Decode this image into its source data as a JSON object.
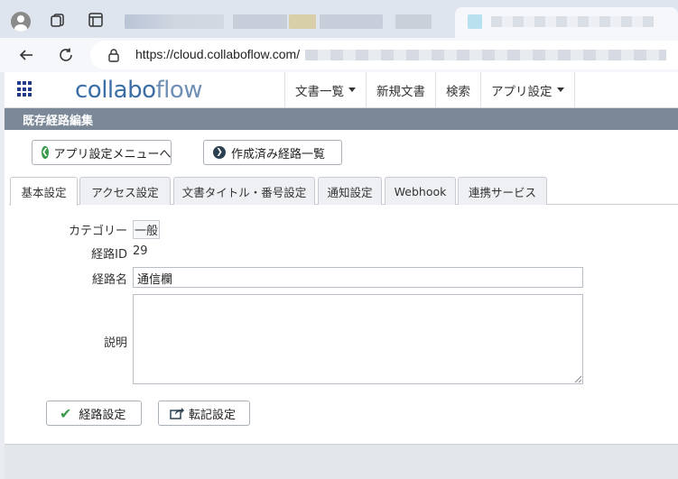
{
  "browser": {
    "url": "https://cloud.collaboflow.com/"
  },
  "app": {
    "logo_main": "collabo",
    "logo_accent": "flow",
    "nav": [
      {
        "label": "文書一覧",
        "dropdown": true
      },
      {
        "label": "新規文書",
        "dropdown": false
      },
      {
        "label": "検索",
        "dropdown": false
      },
      {
        "label": "アプリ設定",
        "dropdown": true
      }
    ]
  },
  "page": {
    "title": "既存経路編集",
    "back_button": "アプリ設定メニューへ",
    "list_button": "作成済み経路一覧"
  },
  "tabs": [
    {
      "label": "基本設定",
      "active": true
    },
    {
      "label": "アクセス設定",
      "active": false
    },
    {
      "label": "文書タイトル・番号設定",
      "active": false
    },
    {
      "label": "通知設定",
      "active": false
    },
    {
      "label": "Webhook",
      "active": false
    },
    {
      "label": "連携サービス",
      "active": false
    }
  ],
  "form": {
    "category_label": "カテゴリー",
    "category_value": "一般",
    "route_id_label": "経路ID",
    "route_id_value": "29",
    "route_name_label": "経路名",
    "route_name_value": "通信欄",
    "description_label": "説明",
    "description_value": ""
  },
  "actions": {
    "route_settings": "経路設定",
    "transfer_settings": "転記設定"
  },
  "colors": {
    "title_bar": "#7a8897",
    "accent_green": "#3a9b4d",
    "logo_blue": "#3a6ea5"
  }
}
